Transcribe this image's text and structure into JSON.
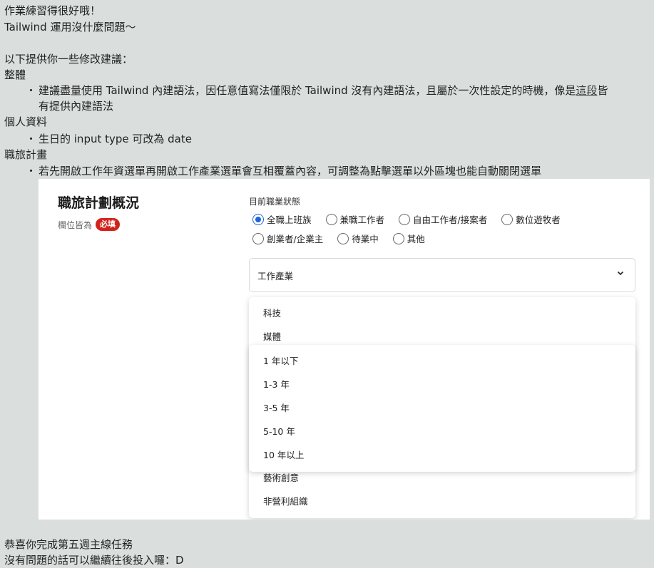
{
  "intro": {
    "line1": "作業練習得很好哦！",
    "line2": "Tailwind 運用沒什麼問題〜",
    "line3": "以下提供你一些修改建議："
  },
  "sections": [
    {
      "heading": "整體",
      "bullet_before_link": "建議盡量使用 Tailwind 內建語法，因任意值寫法僅限於 Tailwind 沒有內建語法，且屬於一次性設定的時機，像是",
      "link_text": "這段",
      "bullet_after_link": "皆",
      "bullet_line2": "有提供內建語法"
    },
    {
      "heading": "個人資料",
      "bullet": "生日的 input type 可改為 date"
    },
    {
      "heading": "職旅計畫",
      "bullet": "若先開啟工作年資選單再開啟工作產業選單會互相覆蓋內容，可調整為點擊選單以外區塊也能自動關閉選單"
    }
  ],
  "bullet_symbol": "・",
  "panel": {
    "title": "職旅計劃概況",
    "subtitle": "欄位皆為",
    "required_badge": "必填",
    "status_label": "目前職業狀態",
    "status_options_row1": [
      "全職上班族",
      "兼職工作者",
      "自由工作者/接案者",
      "數位遊牧者"
    ],
    "status_options_row2": [
      "創業者/企業主",
      "待業中",
      "其他"
    ],
    "selected_status": "全職上班族",
    "industry_select": {
      "value": "工作產業"
    },
    "industry_options_top": [
      "科技",
      "媒體"
    ],
    "industry_options_bottom": [
      "藝術創意",
      "非營利組織"
    ],
    "years_options": [
      "1 年以下",
      "1-3 年",
      "3-5 年",
      "5-10 年",
      "10 年以上"
    ]
  },
  "outro": {
    "line1": "恭喜你完成第五週主線任務",
    "line2": "沒有問題的話可以繼續往後投入囉：D"
  },
  "colors": {
    "background": "#dadfdd",
    "accent": "#1e66d6",
    "badge": "#d1231c"
  }
}
